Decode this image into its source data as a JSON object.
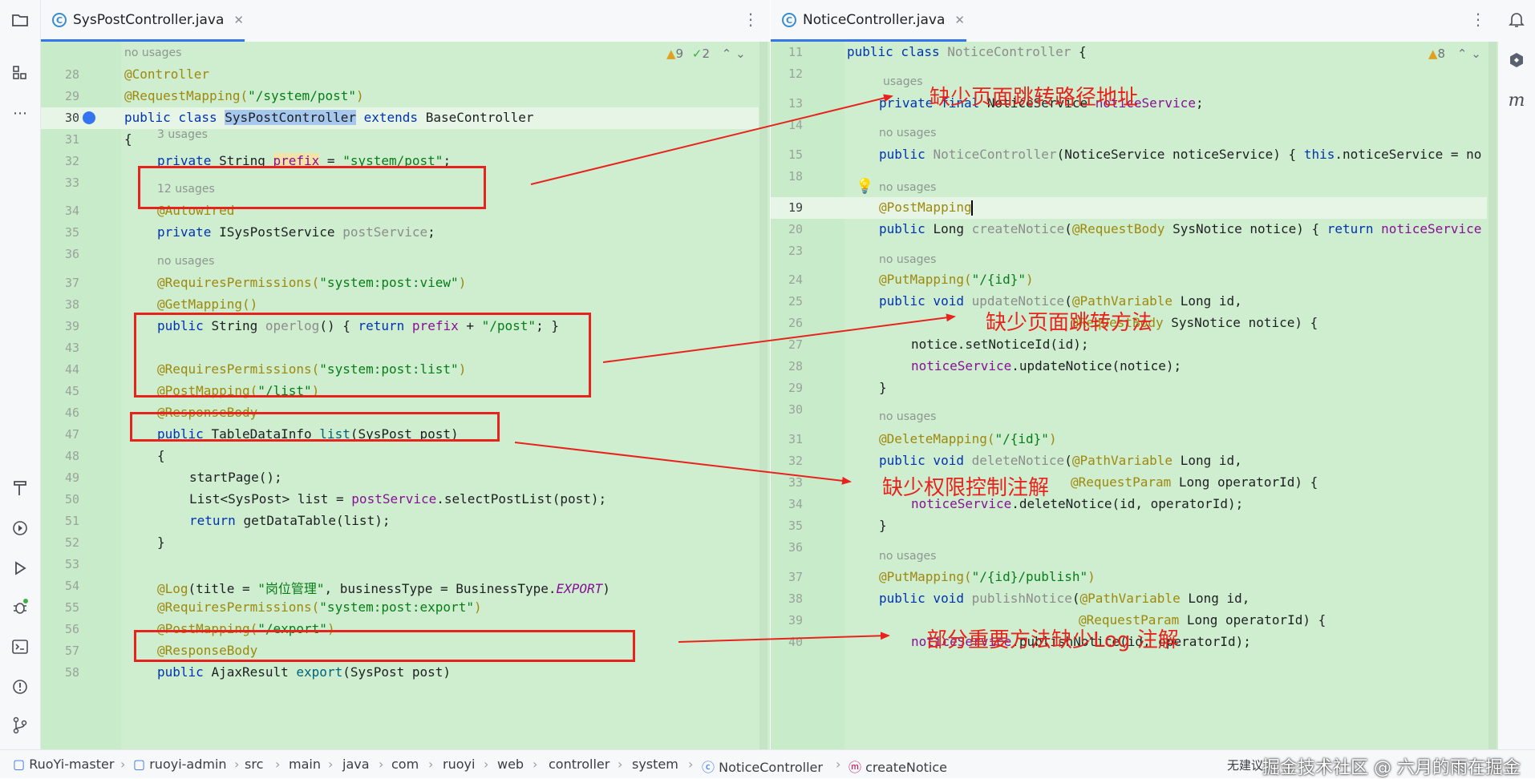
{
  "colors": {
    "accent": "#3574f0",
    "annotation_red": "#e8231d",
    "editor_bg": "#cfeed0"
  },
  "left_tab": {
    "title": "SysPostController.java",
    "icon": "C"
  },
  "right_tab": {
    "title": "NoticeController.java",
    "icon": "C"
  },
  "left_warnings": {
    "warn": "9",
    "ok": "2"
  },
  "right_warnings": {
    "warn": "8"
  },
  "notes": {
    "n1": "缺少页面跳转路径地址",
    "n2": "缺少页面跳转方法",
    "n3": "缺少权限控制注解",
    "n4": "部分重要方法缺少Log 注解"
  },
  "left_code": {
    "l28": "28",
    "l29": "29",
    "l30": "30",
    "l31": "31",
    "l32": "32",
    "l33": "33",
    "l34": "34",
    "l35": "35",
    "l36": "36",
    "l37": "37",
    "l38": "38",
    "l39": "39",
    "l43": "43",
    "l44": "44",
    "l45": "45",
    "l46": "46",
    "l47": "47",
    "l48": "48",
    "l49": "49",
    "l50": "50",
    "l51": "51",
    "l52": "52",
    "l53": "53",
    "l54": "54",
    "l55": "55",
    "l56": "56",
    "l57": "57",
    "l58": "58",
    "hint_nousages": "no usages",
    "hint_3usages": "3 usages",
    "hint_12usages": "12 usages",
    "hint_nousages2": "no usages",
    "t28": "@Controller",
    "t29a": "@RequestMapping(",
    "t29b": "\"/system/post\"",
    "t29c": ")",
    "t30a": "public class ",
    "t30b": "SysPostController",
    "t30c": " extends ",
    "t30d": "BaseController",
    "t31": "{",
    "t32a": "private ",
    "t32b": "String ",
    "t32c": "prefix",
    "t32d": " = ",
    "t32e": "\"system/post\"",
    "t32f": ";",
    "t34": "@Autowired",
    "t35a": "private ",
    "t35b": "ISysPostService ",
    "t35c": "postService",
    "t35d": ";",
    "t37a": "@RequiresPermissions(",
    "t37b": "\"system:post:view\"",
    "t37c": ")",
    "t38": "@GetMapping()",
    "t39a": "public ",
    "t39b": "String ",
    "t39c": "operlog",
    "t39d": "() { ",
    "t39e": "return ",
    "t39f": "prefix",
    "t39g": " + ",
    "t39h": "\"/post\"",
    "t39i": "; }",
    "t44a": "@RequiresPermissions(",
    "t44b": "\"system:post:list\"",
    "t44c": ")",
    "t45a": "@PostMapping(",
    "t45b": "\"/list\"",
    "t45c": ")",
    "t46": "@ResponseBody",
    "t47a": "public ",
    "t47b": "TableDataInfo ",
    "t47c": "list",
    "t47d": "(SysPost post)",
    "t48": "{",
    "t49": "startPage();",
    "t50a": "List<SysPost> list = ",
    "t50b": "postService",
    ".": ".",
    "t50c": ".selectPostList(post);",
    "t51a": "return ",
    "t51b": "getDataTable(list);",
    "t52": "}",
    "t54a": "@Log",
    "t54b": "(title = ",
    "t54c": "\"岗位管理\"",
    "t54d": ", businessType = BusinessType.",
    "t54e": "EXPORT",
    "t54f": ")",
    "t55a": "@RequiresPermissions(",
    "t55b": "\"system:post:export\"",
    "t55c": ")",
    "t56a": "@PostMapping(",
    "t56b": "\"/export\"",
    "t56c": ")",
    "t57": "@ResponseBody",
    "t58a": "public ",
    "t58b": "AjaxResult ",
    "t58c": "export",
    "t58d": "(SysPost post)"
  },
  "right_code": {
    "l11": "11",
    "l12": "12",
    "l13": "13",
    "l14": "14",
    "l15": "15",
    "l18": "18",
    "l19": "19",
    "l20": "20",
    "l23": "23",
    "l24": "24",
    "l25": "25",
    "l26": "26",
    "l27": "27",
    "l28": "28",
    "l29": "29",
    "l30": "30",
    "l31": "31",
    "l32": "32",
    "l33": "33",
    "l34": "34",
    "l35": "35",
    "l36": "36",
    "l37": "37",
    "l38": "38",
    "l39": "39",
    "l40": "40",
    "usages": "usages",
    "nousages": "no usages",
    "t11a": "public class ",
    "t11b": "NoticeController ",
    "t11c": "{",
    "t13a": "private final ",
    "t13b": "NoticeService ",
    "t13c": "noticeService",
    "t13d": ";",
    "t15a": "public ",
    "t15b": "NoticeController",
    "t15c": "(NoticeService noticeService) { ",
    "t15d": "this",
    ".": ".",
    "t15e": ".noticeService = no",
    "t19": "@PostMapping",
    "t20a": "public ",
    "t20b": "Long ",
    "t20c": "createNotice",
    "t20d": "(",
    "t20e": "@RequestBody ",
    "t20f": "SysNotice notice) { ",
    "t20g": "return ",
    "t20h": "noticeService",
    "t24a": "@PutMapping(",
    "t24b": "\"/{id}\"",
    "t24c": ")",
    "t25a": "public void ",
    "t25b": "updateNotice",
    "t25c": "(",
    "t25d": "@PathVariable ",
    "t25e": "Long id,",
    "t26a": "@RequestBody ",
    "t26b": "SysNotice notice) {",
    "t27": "notice.setNoticeId(id);",
    "t28a": "noticeService",
    "t28b": ".updateNotice(notice);",
    "t29": "}",
    "t31a": "@DeleteMapping(",
    "t31b": "\"/{id}\"",
    "t31c": ")",
    "t32a": "public void ",
    "t32b": "deleteNotice",
    "t32c": "(",
    "t32d": "@PathVariable ",
    "t32e": "Long id,",
    "t33a": "@RequestParam ",
    "t33b": "Long operatorId) {",
    "t34a": "noticeService",
    "t34b": ".deleteNotice(id, operatorId);",
    "t35": "}",
    "t37a": "@PutMapping(",
    "t37b": "\"/{id}/publish\"",
    "t37c": ")",
    "t38a": "public void ",
    "t38b": "publishNotice",
    "t38c": "(",
    "t38d": "@PathVariable ",
    "t38e": "Long id,",
    "t39a": "@RequestParam ",
    "t39b": "Long operatorId) {",
    "t40a": "noticeService",
    "t40b": ".publishNotice(id, operatorId);"
  },
  "breadcrumb": [
    "RuoYi-master",
    "ruoyi-admin",
    "src",
    "main",
    "java",
    "com",
    "ruoyi",
    "web",
    "controller",
    "system",
    "NoticeController",
    "createNotice"
  ],
  "watermark": "掘金技术社区 @ 六月的雨在掘金",
  "status_ime": "无建议"
}
